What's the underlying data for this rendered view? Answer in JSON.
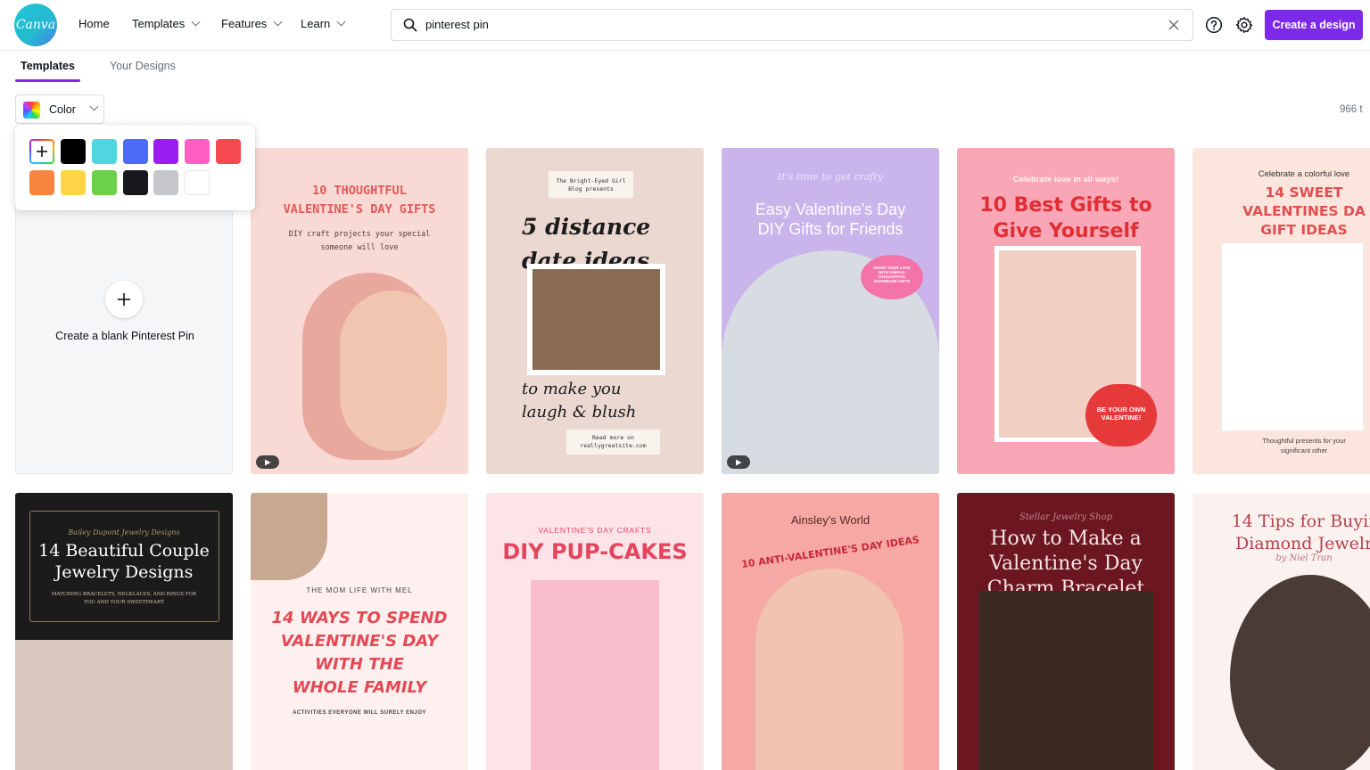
{
  "header": {
    "logo_text": "Canva",
    "nav": [
      {
        "label": "Home",
        "has_dropdown": false
      },
      {
        "label": "Templates",
        "has_dropdown": true
      },
      {
        "label": "Features",
        "has_dropdown": true
      },
      {
        "label": "Learn",
        "has_dropdown": true
      }
    ],
    "search_value": "pinterest pin",
    "create_label": "Create a design"
  },
  "tabs": [
    {
      "label": "Templates",
      "active": true
    },
    {
      "label": "Your Designs",
      "active": false
    }
  ],
  "filter": {
    "color_label": "Color",
    "result_count": "966 t"
  },
  "palette": {
    "row1": [
      "add",
      "#000000",
      "#4fd6df",
      "#4a6cf7",
      "#9b1df2",
      "#ff5fc3",
      "#f5484f"
    ],
    "row2": [
      "#f7853f",
      "#ffd447",
      "#6dd04b",
      "#16181b",
      "#c5c7ca",
      "#ffffff"
    ]
  },
  "blank_card": {
    "label": "Create a blank Pinterest Pin"
  },
  "templates": [
    {
      "lines": [
        "10 THOUGHTFUL",
        "VALENTINE'S DAY GIFTS"
      ],
      "sub": [
        "DIY craft projects your special",
        "someone will love"
      ],
      "bg": "#f9d9d4",
      "video": true
    },
    {
      "lines": [
        "5 distance",
        "date ideas"
      ],
      "top": [
        "The Bright-Eyed Girl",
        "Blog presents"
      ],
      "bottom": [
        "to make you",
        "laugh & blush"
      ],
      "footer": [
        "Read more on",
        "reallygreatsite.com"
      ],
      "bg": "#ead8d1",
      "video": false
    },
    {
      "lines": [
        "Easy Valentine's Day",
        "DIY Gifts for Friends"
      ],
      "kicker": "It's time to get crafty",
      "badge": "SHOW YOUR LOVE WITH SIMPLE, THOUGHTFUL HANDMADE GIFTS",
      "bg": "#c9b4ec",
      "video": true
    },
    {
      "lines": [
        "10 Best Gifts to",
        "Give Yourself"
      ],
      "kicker": "Celebrate love in all ways!",
      "badge": "BE YOUR OWN VALENTINE!",
      "bg": "#f9a6b7",
      "video": false
    },
    {
      "lines": [
        "14 SWEET",
        "VALENTINES DA",
        "GIFT IDEAS"
      ],
      "kicker": "Celebrate a colorful love",
      "sub": [
        "Thoughtful presents for your",
        "significant other"
      ],
      "bg": "#fbe5dd",
      "video": false
    },
    {
      "lines": [
        "14 Beautiful Couple",
        "Jewelry Designs"
      ],
      "kicker": "Bailey Dupont Jewelry Designs",
      "sub": [
        "MATCHING BRACELETS, NECKLACES, AND RINGS FOR",
        "YOU AND YOUR SWEETHEART"
      ],
      "bg": "#1b1b1b",
      "video": false
    },
    {
      "lines": [
        "14 WAYS TO SPEND",
        "VALENTINE'S DAY",
        "WITH THE",
        "WHOLE FAMILY"
      ],
      "kicker": "THE MOM LIFE WITH MEL",
      "sub": [
        "ACTIVITIES EVERYONE WILL SURELY ENJOY"
      ],
      "bg": "#fdf0ef",
      "video": false
    },
    {
      "lines": [
        "DIY PUP-CAKES"
      ],
      "kicker": "VALENTINE'S DAY CRAFTS",
      "bg": "#fde4e8",
      "video": false
    },
    {
      "lines": [
        "10 ANTI-VALENTINE'S DAY IDEAS"
      ],
      "kicker": "Ainsley's World",
      "bg": "#f6a9a4",
      "video": false
    },
    {
      "lines": [
        "How to Make a",
        "Valentine's Day",
        "Charm Bracelet"
      ],
      "kicker": "Stellar Jewelry Shop",
      "bg": "#6b1621",
      "video": false
    },
    {
      "lines": [
        "14 Tips for Buyir",
        "Diamond Jewelr"
      ],
      "kicker": "by Niel Tran",
      "bg": "#fbf2f0",
      "video": false
    }
  ],
  "colors": {
    "accent": "#7d2ae8",
    "text": "#0e1318",
    "muted": "#6b6f75"
  }
}
